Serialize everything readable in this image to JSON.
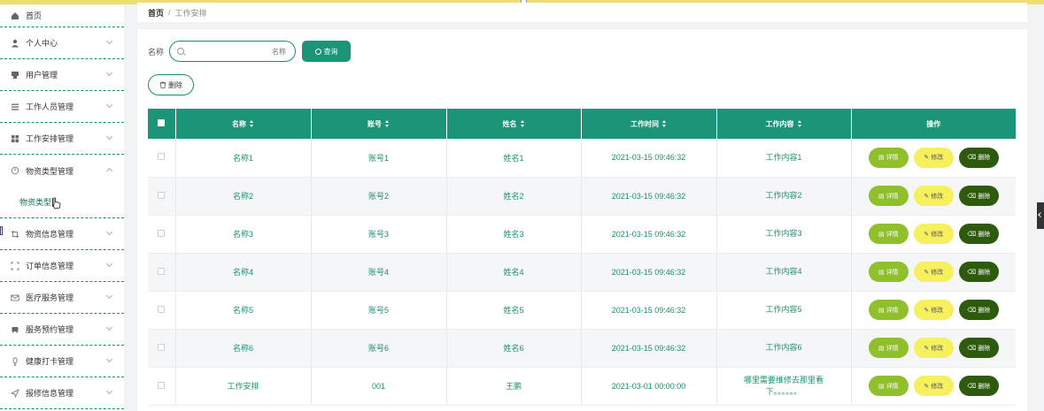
{
  "sidebar": {
    "items": [
      {
        "label": "首页",
        "icon": "home-icon"
      },
      {
        "label": "个人中心",
        "icon": "user-icon"
      },
      {
        "label": "用户管理",
        "icon": "users-icon"
      },
      {
        "label": "工作人员管理",
        "icon": "list-icon"
      },
      {
        "label": "工作安排管理",
        "icon": "grid-icon"
      },
      {
        "label": "物资类型管理",
        "icon": "clock-icon"
      },
      {
        "label": "物资信息管理",
        "icon": "crop-icon"
      },
      {
        "label": "订单信息管理",
        "icon": "frame-icon"
      },
      {
        "label": "医疗服务管理",
        "icon": "mail-icon"
      },
      {
        "label": "服务预约管理",
        "icon": "car-icon"
      },
      {
        "label": "健康打卡管理",
        "icon": "bulb-icon"
      },
      {
        "label": "报修信息管理",
        "icon": "send-icon"
      }
    ],
    "sub_item": "物资类型"
  },
  "breadcrumb": {
    "home": "首页",
    "separator": "/",
    "current": "工作安排"
  },
  "search": {
    "label": "名称",
    "placeholder": "名称",
    "button": "查询"
  },
  "toolbar": {
    "delete": "删除"
  },
  "table": {
    "headers": [
      "名称",
      "账号",
      "姓名",
      "工作时间",
      "工作内容",
      "操作"
    ],
    "rows": [
      {
        "name": "名称1",
        "account": "账号1",
        "person": "姓名1",
        "time": "2021-03-15 09:46:32",
        "content": "工作内容1"
      },
      {
        "name": "名称2",
        "account": "账号2",
        "person": "姓名2",
        "time": "2021-03-15 09:46:32",
        "content": "工作内容2"
      },
      {
        "name": "名称3",
        "account": "账号3",
        "person": "姓名3",
        "time": "2021-03-15 09:46:32",
        "content": "工作内容3"
      },
      {
        "name": "名称4",
        "account": "账号4",
        "person": "姓名4",
        "time": "2021-03-15 09:46:32",
        "content": "工作内容4"
      },
      {
        "name": "名称5",
        "account": "账号5",
        "person": "姓名5",
        "time": "2021-03-15 09:46:32",
        "content": "工作内容5"
      },
      {
        "name": "名称6",
        "account": "账号6",
        "person": "姓名6",
        "time": "2021-03-15 09:46:32",
        "content": "工作内容6"
      },
      {
        "name": "工作安排",
        "account": "001",
        "person": "王鹏",
        "time": "2021-03-01 00:00:00",
        "content": "哪里需要维修去那里看下。。。。。。"
      }
    ],
    "actions": {
      "detail": "详情",
      "edit": "修改",
      "delete": "删除"
    }
  },
  "colors": {
    "primary": "#1b9478",
    "detail": "#8fbf2b",
    "edit": "#f6ef5e",
    "delete": "#2d5a0c",
    "topbar": "#ecdd74"
  }
}
